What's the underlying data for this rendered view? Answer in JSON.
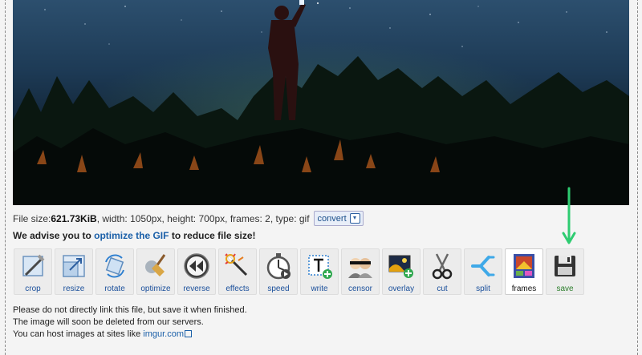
{
  "file_info": {
    "prefix": "File size: ",
    "size": "621.73KiB",
    "details": ", width: 1050px, height: 700px, frames: 2, type: gif",
    "convert_label": "convert"
  },
  "advice": {
    "before": "We advise you to ",
    "link": "optimize the GIF",
    "after": " to reduce file size!"
  },
  "tools": [
    {
      "label": "crop",
      "icon": "crop-icon"
    },
    {
      "label": "resize",
      "icon": "resize-icon"
    },
    {
      "label": "rotate",
      "icon": "rotate-icon"
    },
    {
      "label": "optimize",
      "icon": "broom-icon"
    },
    {
      "label": "reverse",
      "icon": "rewind-icon"
    },
    {
      "label": "effects",
      "icon": "magic-wand-icon"
    },
    {
      "label": "speed",
      "icon": "stopwatch-icon"
    },
    {
      "label": "write",
      "icon": "text-icon"
    },
    {
      "label": "censor",
      "icon": "censor-icon"
    },
    {
      "label": "overlay",
      "icon": "overlay-icon"
    },
    {
      "label": "cut",
      "icon": "scissors-icon"
    },
    {
      "label": "split",
      "icon": "split-icon"
    },
    {
      "label": "frames",
      "icon": "frames-icon"
    },
    {
      "label": "save",
      "icon": "floppy-disk-icon"
    }
  ],
  "notes": {
    "line1": "Please do not directly link this file, but save it when finished.",
    "line2": "The image will soon be deleted from our servers.",
    "line3_prefix": "You can host images at sites like ",
    "line3_link": "imgur.com"
  },
  "colors": {
    "link": "#1a5fa8",
    "arrow": "#2ecc71",
    "save_label": "#2a7d2a"
  }
}
